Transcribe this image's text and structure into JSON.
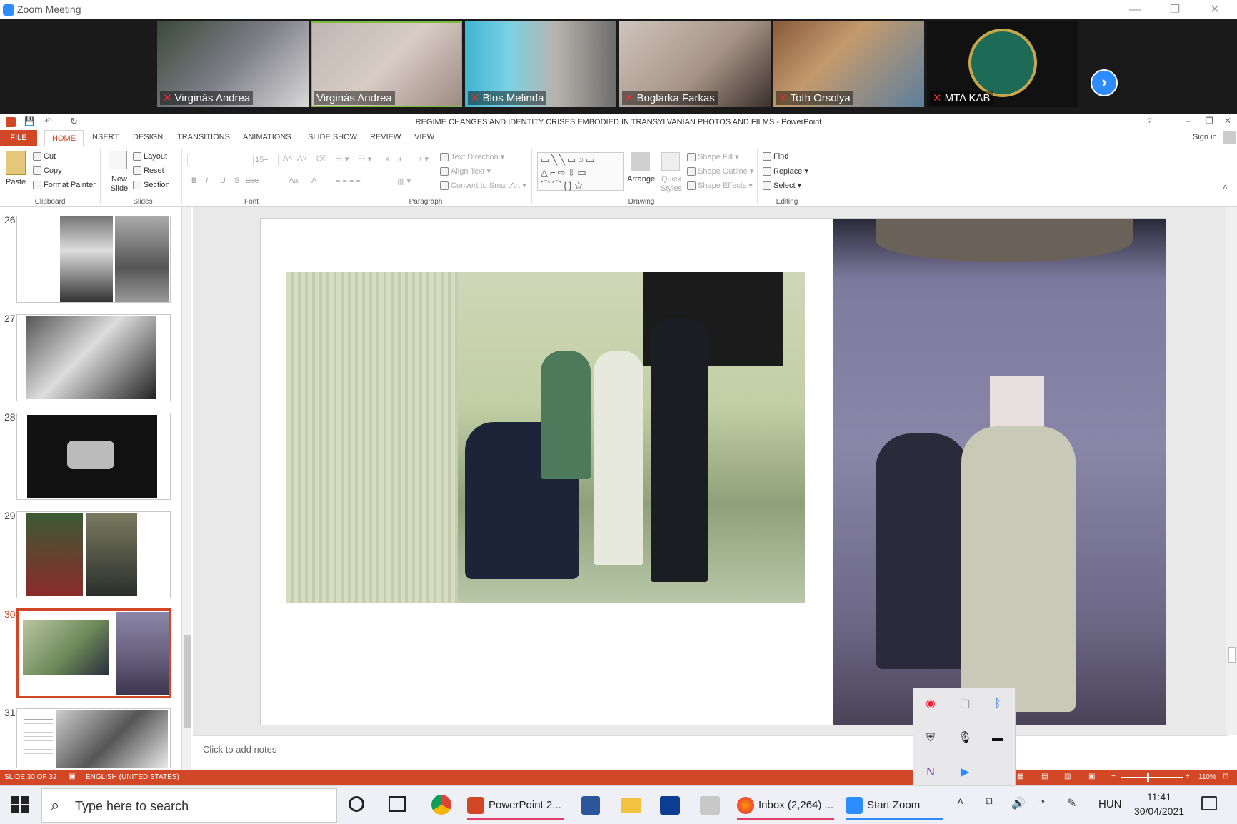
{
  "zoom": {
    "window_title": "Zoom Meeting",
    "participants": [
      {
        "name": "Virginás Andrea",
        "muted": true
      },
      {
        "name": "Virginás Andrea",
        "muted": false
      },
      {
        "name": "Blos Melinda",
        "muted": true
      },
      {
        "name": "Boglárka Farkas",
        "muted": true
      },
      {
        "name": "Toth Orsolya",
        "muted": true
      },
      {
        "name": "MTA KAB",
        "muted": true
      }
    ],
    "next_icon": "chevron-right-icon"
  },
  "powerpoint": {
    "title": "REGIME CHANGES AND IDENTITY CRISES EMBODIED IN TRANSYLVANIAN PHOTOS AND FILMS - PowerPoint",
    "sign_in": "Sign in",
    "tabs": [
      "FILE",
      "HOME",
      "INSERT",
      "DESIGN",
      "TRANSITIONS",
      "ANIMATIONS",
      "SLIDE SHOW",
      "REVIEW",
      "VIEW"
    ],
    "ribbon": {
      "clipboard": {
        "paste": "Paste",
        "cut": "Cut",
        "copy": "Copy",
        "format_painter": "Format Painter",
        "label": "Clipboard"
      },
      "slides": {
        "new_slide": "New Slide",
        "layout": "Layout",
        "reset": "Reset",
        "section": "Section",
        "label": "Slides"
      },
      "font": {
        "font_size": "15+",
        "label": "Font",
        "bold": "B",
        "italic": "I",
        "underline": "U",
        "shadow": "S",
        "strike": "abc",
        "change_case": "Aa"
      },
      "paragraph": {
        "text_direction": "Text Direction",
        "align_text": "Align Text",
        "convert_smartart": "Convert to SmartArt",
        "label": "Paragraph"
      },
      "drawing": {
        "arrange": "Arrange",
        "quick_styles": "Quick Styles",
        "shape_fill": "Shape Fill",
        "shape_outline": "Shape Outline",
        "shape_effects": "Shape Effects",
        "label": "Drawing"
      },
      "editing": {
        "find": "Find",
        "replace": "Replace",
        "select": "Select",
        "label": "Editing"
      }
    },
    "slides": [
      {
        "num": "26"
      },
      {
        "num": "27"
      },
      {
        "num": "28"
      },
      {
        "num": "29"
      },
      {
        "num": "30",
        "selected": true
      },
      {
        "num": "31"
      }
    ],
    "notes_placeholder": "Click to add notes",
    "status": {
      "slide": "SLIDE 30 OF 32",
      "language": "ENGLISH (UNITED STATES)",
      "zoom": "110%"
    }
  },
  "taskbar": {
    "search_placeholder": "Type here to search",
    "apps": [
      "PowerPoint 2...",
      "Inbox (2,264) ...",
      "Start Zoom"
    ],
    "lang": "HUN",
    "time": "11:41",
    "date": "30/04/2021"
  },
  "colors": {
    "accent": "#d24726",
    "zoom_blue": "#2d8cff"
  }
}
